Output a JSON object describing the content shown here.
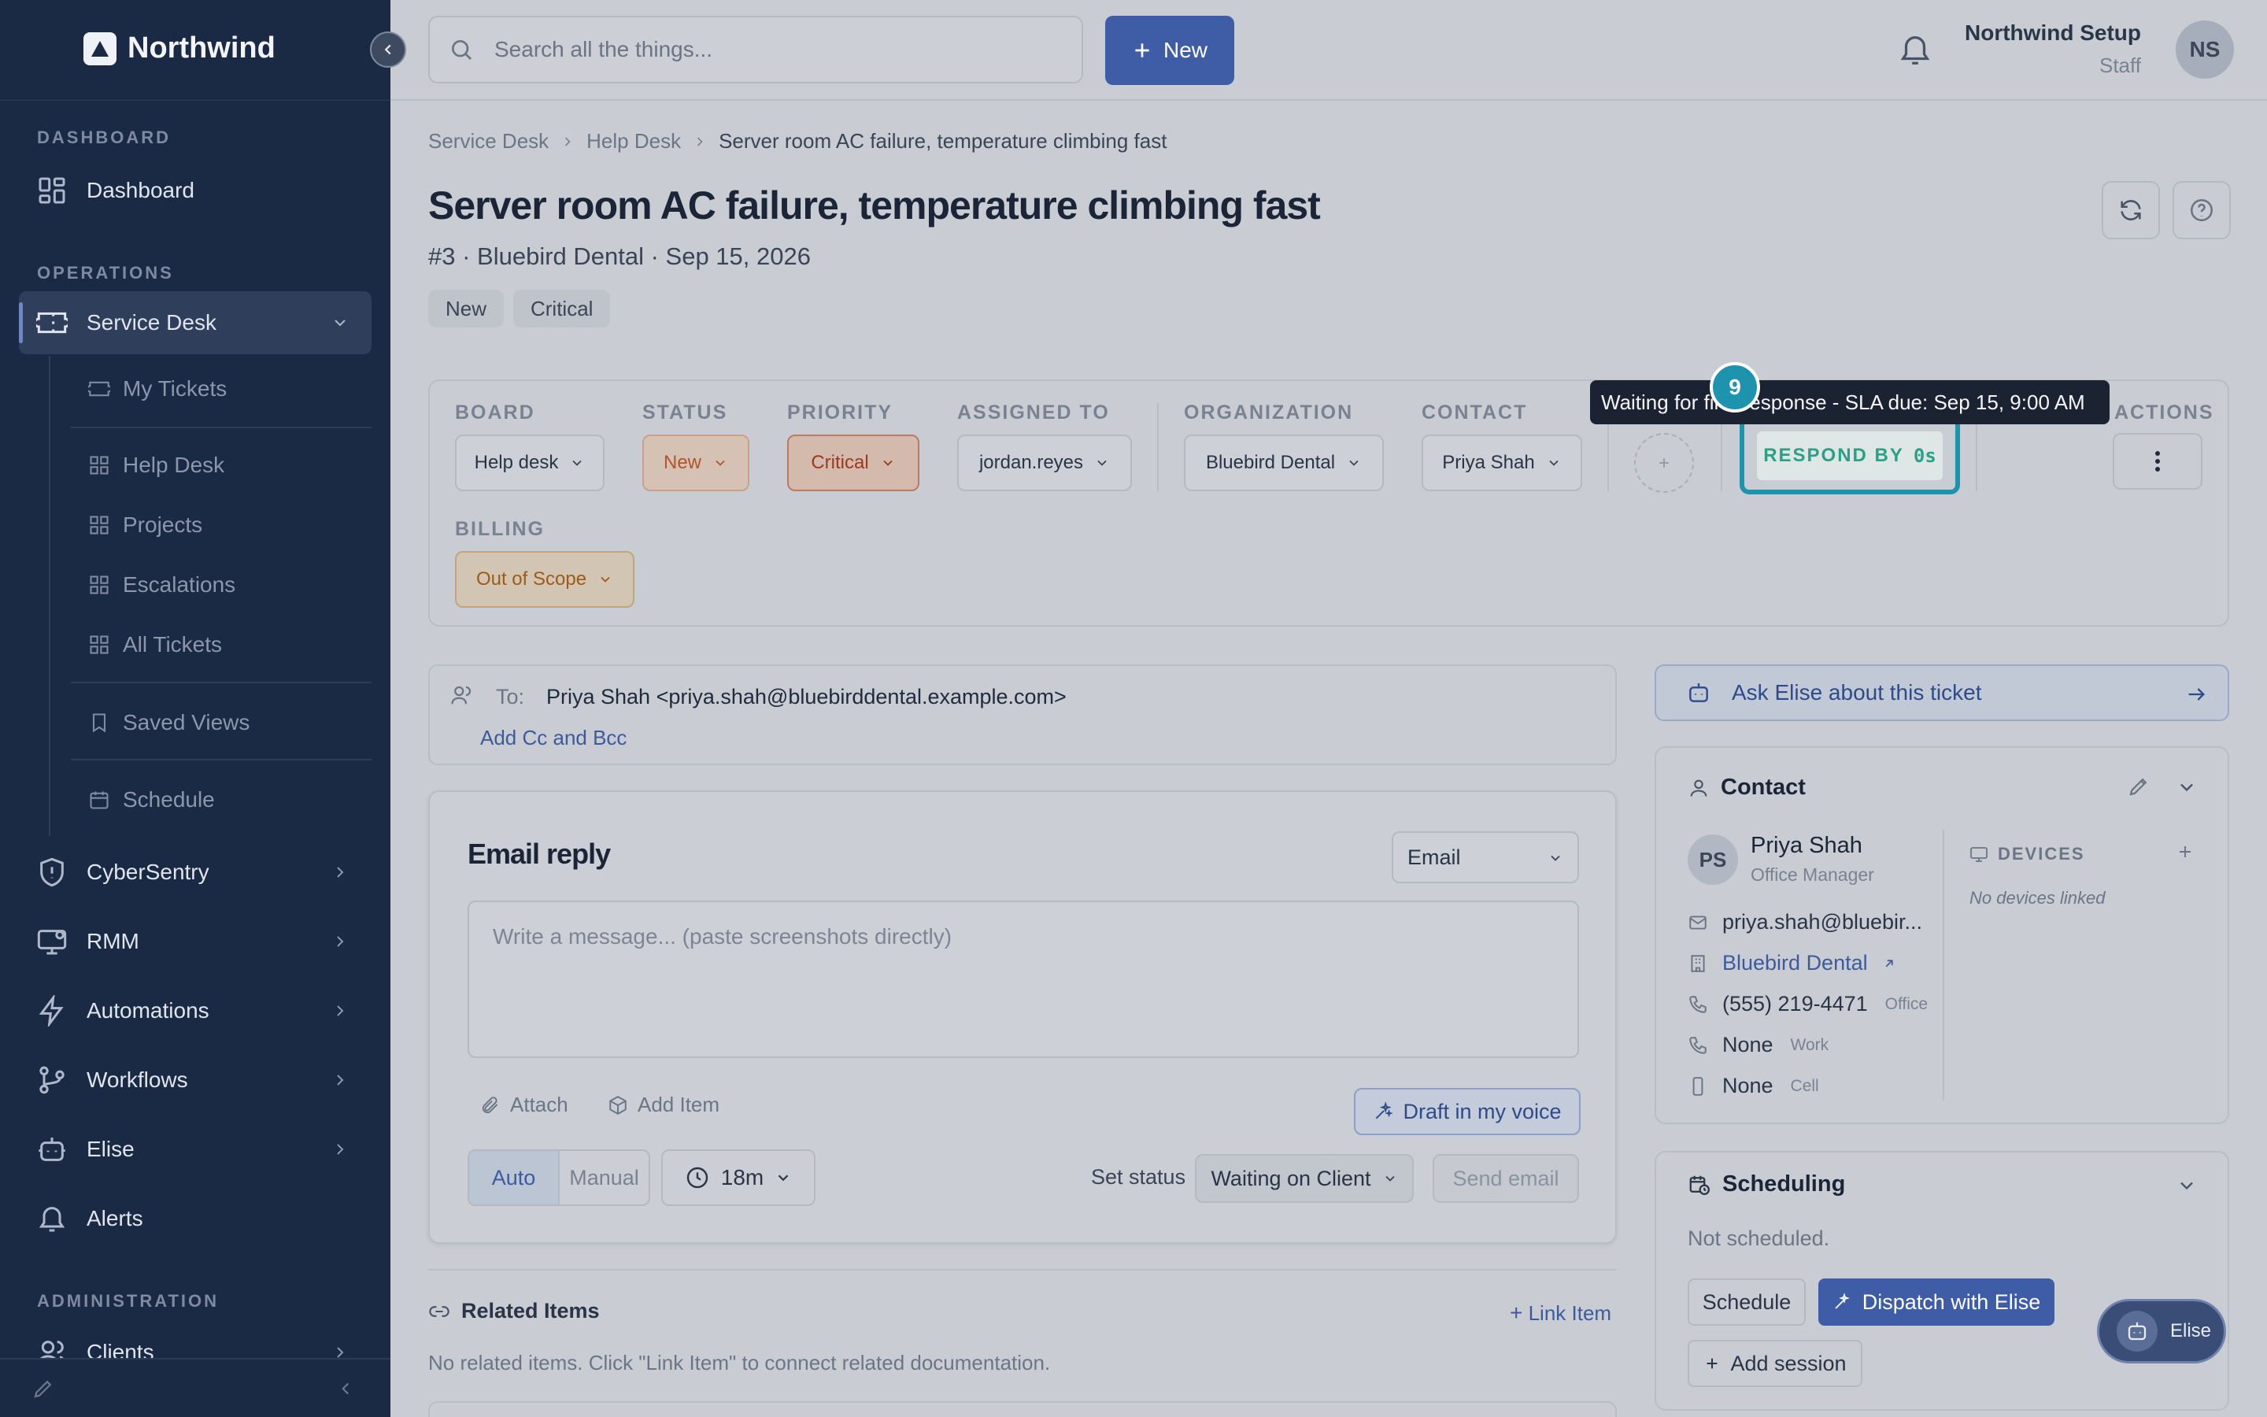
{
  "app": {
    "name": "Northwind"
  },
  "sidebar": {
    "sections": {
      "dashboard": "DASHBOARD",
      "operations": "OPERATIONS",
      "administration": "ADMINISTRATION"
    },
    "items": {
      "dashboard": "Dashboard",
      "service_desk": "Service Desk",
      "cybersentry": "CyberSentry",
      "rmm": "RMM",
      "automations": "Automations",
      "workflows": "Workflows",
      "elise": "Elise",
      "alerts": "Alerts",
      "clients": "Clients"
    },
    "sub_items": {
      "my_tickets": "My Tickets",
      "help_desk": "Help Desk",
      "projects": "Projects",
      "escalations": "Escalations",
      "all_tickets": "All Tickets",
      "saved_views": "Saved Views",
      "schedule": "Schedule"
    }
  },
  "topbar": {
    "search_placeholder": "Search all the things...",
    "new_label": "New",
    "user_name": "Northwind Setup",
    "user_role": "Staff",
    "avatar_initials": "NS"
  },
  "breadcrumb": [
    "Service Desk",
    "Help Desk",
    "Server room AC failure, temperature climbing fast"
  ],
  "ticket": {
    "title": "Server room AC failure, temperature climbing fast",
    "meta": "#3 · Bluebird Dental · Sep 15, 2026",
    "tags": [
      "New",
      "Critical"
    ]
  },
  "fields": {
    "labels": {
      "board": "BOARD",
      "status": "STATUS",
      "priority": "PRIORITY",
      "assigned": "ASSIGNED TO",
      "organization": "ORGANIZATION",
      "contact": "CONTACT",
      "actions": "ACTIONS",
      "billing": "BILLING"
    },
    "values": {
      "board": "Help desk",
      "status": "New",
      "priority": "Critical",
      "assigned": "jordan.reyes",
      "organization": "Bluebird Dental",
      "contact": "Priya Shah",
      "billing": "Out of Scope"
    },
    "status_color": "#b2532a",
    "priority_color": "#9c3a1e"
  },
  "sla": {
    "label": "RESPOND BY",
    "value": "0s",
    "tooltip": "Waiting for first response - SLA due: Sep 15, 9:00 AM",
    "badge": "9",
    "accent": "#1e93ad"
  },
  "email": {
    "to_label": "To:",
    "to_value": "Priya Shah <priya.shah@bluebirddental.example.com>",
    "add_cc": "Add Cc and Bcc",
    "reply_title": "Email reply",
    "channel": "Email",
    "message_placeholder": "Write a message... (paste screenshots directly)",
    "attach": "Attach",
    "add_item": "Add Item",
    "draft": "Draft in my voice",
    "mode_auto": "Auto",
    "mode_manual": "Manual",
    "timer": "18m",
    "set_status_label": "Set status",
    "set_status_value": "Waiting on Client",
    "send": "Send email"
  },
  "related": {
    "title": "Related Items",
    "link_item": "Link Item",
    "empty": "No related items. Click \"Link Item\" to connect related documentation."
  },
  "ask_elise": "Ask Elise about this ticket",
  "contact": {
    "title": "Contact",
    "initials": "PS",
    "name": "Priya Shah",
    "role": "Office Manager",
    "email": "priya.shah@bluebir...",
    "org": "Bluebird Dental",
    "phone_office": "(555) 219-4471",
    "phone_office_label": "Office",
    "phone_work": "None",
    "phone_work_label": "Work",
    "phone_cell": "None",
    "phone_cell_label": "Cell",
    "devices_label": "DEVICES",
    "devices_empty": "No devices linked"
  },
  "scheduling": {
    "title": "Scheduling",
    "empty": "Not scheduled.",
    "schedule": "Schedule",
    "dispatch": "Dispatch with Elise",
    "add_session": "Add session"
  },
  "elise_fab": "Elise"
}
